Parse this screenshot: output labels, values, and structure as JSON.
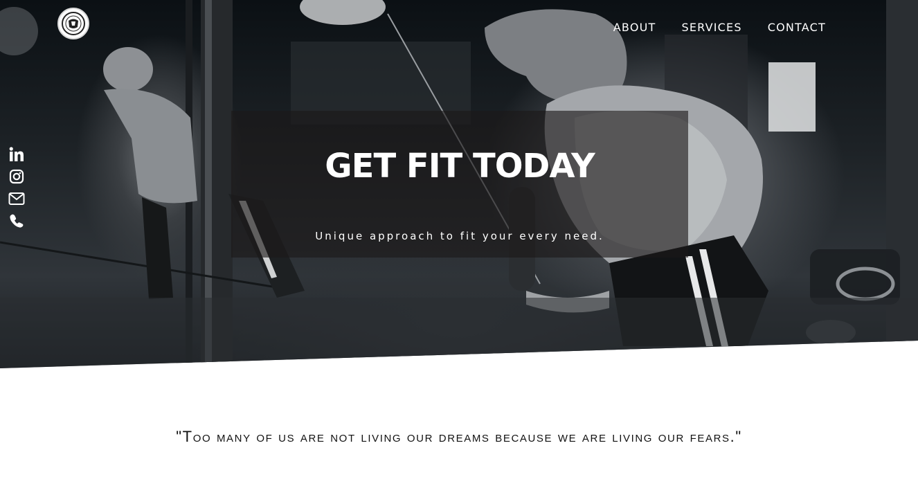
{
  "header": {
    "logo_name": "logo-emblem",
    "nav": [
      {
        "label": "ABOUT"
      },
      {
        "label": "SERVICES"
      },
      {
        "label": "CONTACT"
      }
    ]
  },
  "social": [
    {
      "icon": "linkedin-icon"
    },
    {
      "icon": "instagram-icon"
    },
    {
      "icon": "mail-icon"
    },
    {
      "icon": "phone-icon"
    }
  ],
  "hero": {
    "title": "GET FIT TODAY",
    "subtitle": "Unique approach to fit your every need."
  },
  "quote": {
    "text": "\"Too many of us are not living our dreams because we are living our fears.\""
  },
  "colors": {
    "hero_overlay": "#1c1818",
    "text_light": "#ffffff",
    "text_dark": "#111111",
    "page_background": "#ffffff"
  }
}
